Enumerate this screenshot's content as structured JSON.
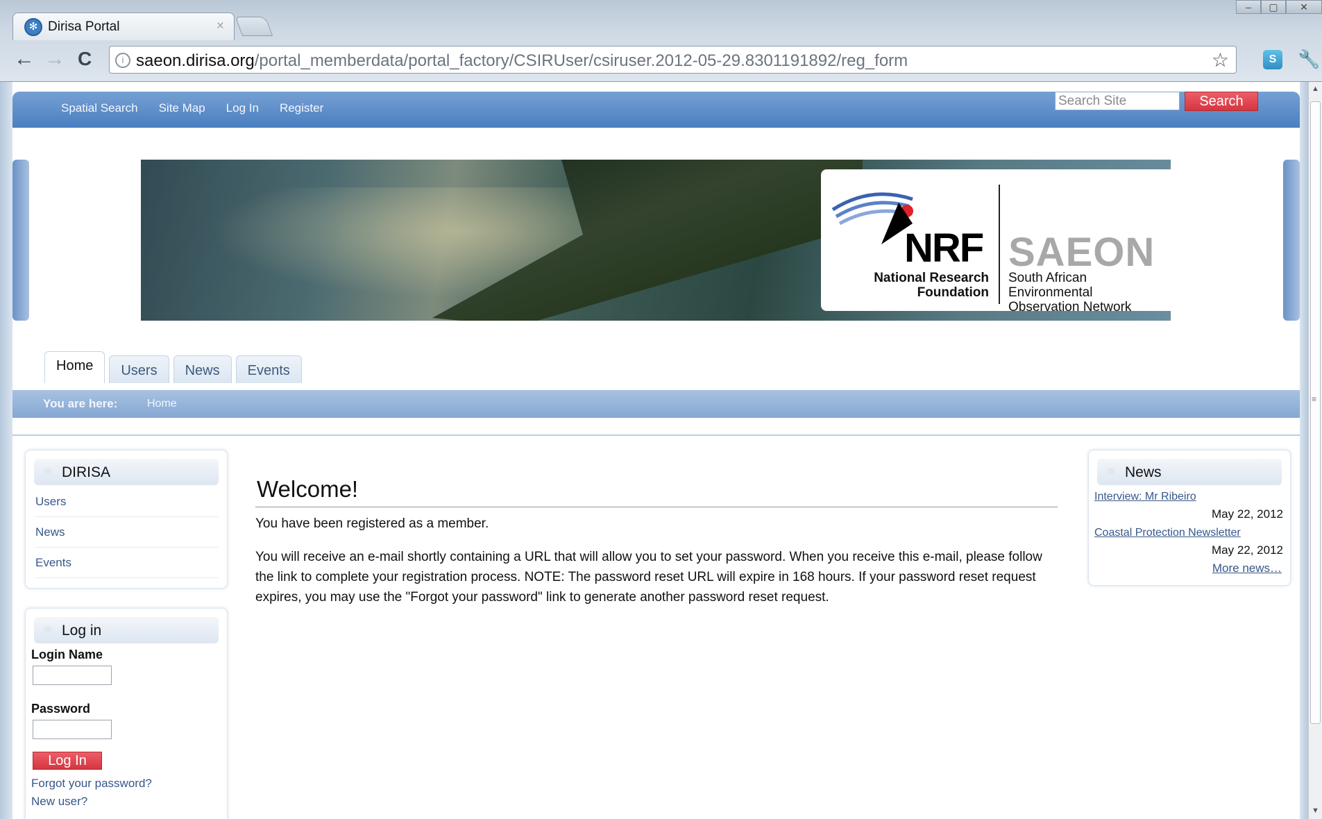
{
  "browser": {
    "tab_title": "Dirisa Portal",
    "tab_close": "×",
    "url_host": "saeon.dirisa.org",
    "url_path": "/portal_memberdata/portal_factory/CSIRUser/csiruser.2012-05-29.8301191892/reg_form",
    "back_glyph": "←",
    "forward_glyph": "→",
    "reload_glyph": "C",
    "star_glyph": "☆"
  },
  "site_actions": [
    "Spatial Search",
    "Site Map",
    "Log In",
    "Register"
  ],
  "search": {
    "placeholder": "Search Site",
    "button": "Search"
  },
  "banner": {
    "nrf_logo": "NRF",
    "nrf_sub_1": "National Research",
    "nrf_sub_2": "Foundation",
    "saeon_logo": "SAEON",
    "saeon_sub_1": "South African Environmental",
    "saeon_sub_2": "Observation Network"
  },
  "tabs": [
    "Home",
    "Users",
    "News",
    "Events"
  ],
  "active_tab": "Home",
  "breadcrumb": {
    "label": "You are here:",
    "home": "Home"
  },
  "dirisa_portlet": {
    "title": "DIRISA",
    "items": [
      "Users",
      "News",
      "Events"
    ]
  },
  "login_portlet": {
    "title": "Log in",
    "login_name_label": "Login Name",
    "password_label": "Password",
    "button": "Log In",
    "forgot": "Forgot your password?",
    "new_user": "New user?"
  },
  "content": {
    "heading": "Welcome!",
    "registered": "You have been registered as a member.",
    "message": "You will receive an e-mail shortly containing a URL that will allow you to set your password. When you receive this e-mail, please follow the link to complete your registration process. NOTE: The password reset URL will expire in 168 hours. If your password reset request expires, you may use the \"Forgot your password\" link to generate another password reset request."
  },
  "news_portlet": {
    "title": "News",
    "items": [
      {
        "title": "Interview: Mr Ribeiro",
        "date": "May 22, 2012"
      },
      {
        "title": "Coastal Protection Newsletter",
        "date": "May 22, 2012"
      }
    ],
    "more": "More news…"
  },
  "colors": {
    "nav_blue": "#4a7fc0",
    "breadcrumb_blue": "#85a7d3",
    "button_red": "#d6353f",
    "link_blue": "#37578a"
  }
}
